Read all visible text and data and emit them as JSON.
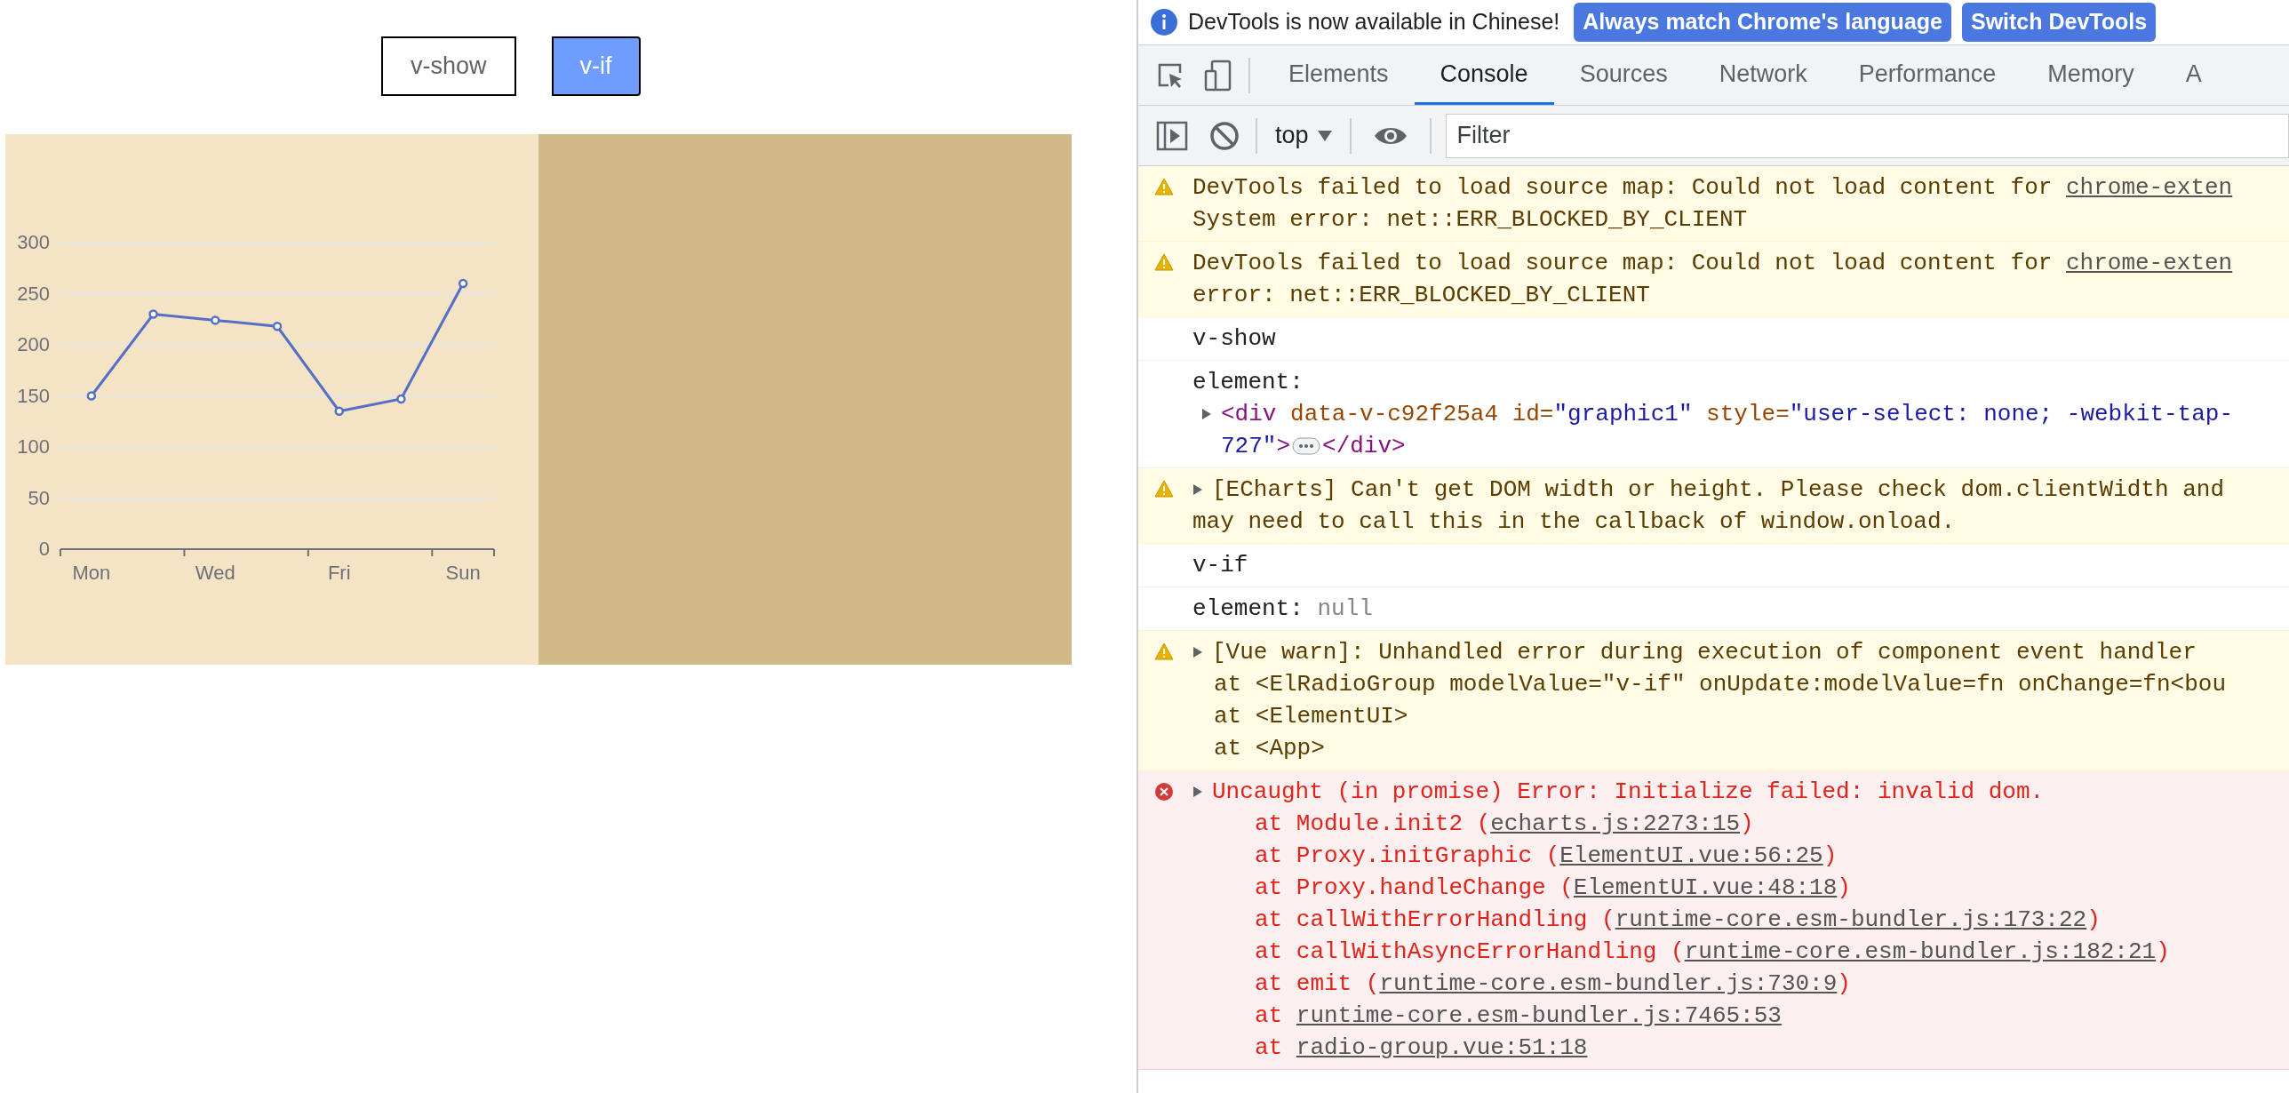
{
  "page": {
    "radio_buttons": [
      {
        "label": "v-show",
        "selected": false
      },
      {
        "label": "v-if",
        "selected": true
      }
    ],
    "chart": {
      "chart_data": {
        "type": "line",
        "categories": [
          "Mon",
          null,
          "Wed",
          null,
          "Fri",
          null,
          "Sun"
        ],
        "ylim": [
          0,
          300
        ],
        "grid": true,
        "yticks": [
          0,
          50,
          100,
          150,
          200,
          250,
          300
        ],
        "series": [
          {
            "color": "#5470c6",
            "marker": "circle",
            "values": [
              150,
              230,
              224,
              218,
              135,
              147,
              260
            ]
          }
        ]
      }
    }
  },
  "devtools": {
    "infobar": {
      "message": "DevTools is now available in Chinese!",
      "buttons": [
        "Always match Chrome's language",
        "Switch DevTools"
      ]
    },
    "tabs": [
      {
        "label": "Elements",
        "selected": false
      },
      {
        "label": "Console",
        "selected": true
      },
      {
        "label": "Sources",
        "selected": false
      },
      {
        "label": "Network",
        "selected": false
      },
      {
        "label": "Performance",
        "selected": false
      },
      {
        "label": "Memory",
        "selected": false
      },
      {
        "label": "A",
        "selected": false
      }
    ],
    "toolbar": {
      "context": "top",
      "filter_placeholder": "Filter"
    },
    "console": [
      {
        "kind": "warning",
        "expandable": false,
        "lines": [
          {
            "text": "DevTools failed to load source map: Could not load content for ",
            "link": "chrome-exten"
          },
          {
            "text": "System error: net::ERR_BLOCKED_BY_CLIENT"
          }
        ]
      },
      {
        "kind": "warning",
        "expandable": false,
        "lines": [
          {
            "text": "DevTools failed to load source map: Could not load content for ",
            "link": "chrome-exten"
          },
          {
            "text": "error: net::ERR_BLOCKED_BY_CLIENT"
          }
        ]
      },
      {
        "kind": "log",
        "expandable": false,
        "lines": [
          {
            "text": "v-show"
          }
        ]
      },
      {
        "kind": "log",
        "expandable": false,
        "lines": [
          {
            "text": "element:"
          }
        ],
        "node": [
          [
            {
              "kind": "tag",
              "text": "<div"
            },
            {
              "kind": "attr",
              "text": " data-v-c92f25a4"
            },
            {
              "kind": "attr",
              "text": " id="
            },
            {
              "kind": "value",
              "text": "\"graphic1\""
            },
            {
              "kind": "attr",
              "text": " style="
            },
            {
              "kind": "value",
              "text": "\"user-select: none; -webkit-tap-"
            }
          ],
          [
            {
              "kind": "value",
              "text": "727\""
            },
            {
              "kind": "tag",
              "text": ">"
            },
            {
              "kind": "ellipsis"
            },
            {
              "kind": "tag",
              "text": "</div>"
            }
          ]
        ]
      },
      {
        "kind": "warning",
        "expandable": true,
        "lines": [
          {
            "text": "[ECharts] Can't get DOM width or height. Please check dom.clientWidth and"
          },
          {
            "text": "may need to call this in the callback of window.onload."
          }
        ]
      },
      {
        "kind": "log",
        "expandable": false,
        "lines": [
          {
            "text": "v-if"
          }
        ]
      },
      {
        "kind": "log",
        "expandable": false,
        "lines": [
          {
            "text": "element: ",
            "value": "null"
          }
        ]
      },
      {
        "kind": "warning",
        "expandable": true,
        "lines": [
          {
            "text": "[Vue warn]: Unhandled error during execution of component event handler"
          }
        ],
        "details": [
          {
            "text": "at <ElRadioGroup modelValue=\"v-if\" onUpdate:modelValue=fn onChange=fn<bou"
          },
          {
            "text": "at <ElementUI>"
          },
          {
            "text": "at <App>"
          }
        ]
      },
      {
        "kind": "error",
        "expandable": true,
        "lines": [
          {
            "text": "Uncaught (in promise) Error: Initialize failed: invalid dom."
          }
        ],
        "stack": [
          {
            "text": "at Module.init2 (",
            "link": "echarts.js:2273:15",
            "after": ")"
          },
          {
            "text": "at Proxy.initGraphic (",
            "link": "ElementUI.vue:56:25",
            "after": ")"
          },
          {
            "text": "at Proxy.handleChange (",
            "link": "ElementUI.vue:48:18",
            "after": ")"
          },
          {
            "text": "at callWithErrorHandling (",
            "link": "runtime-core.esm-bundler.js:173:22",
            "after": ")"
          },
          {
            "text": "at callWithAsyncErrorHandling (",
            "link": "runtime-core.esm-bundler.js:182:21",
            "after": ")"
          },
          {
            "text": "at emit (",
            "link": "runtime-core.esm-bundler.js:730:9",
            "after": ")"
          },
          {
            "text": "at ",
            "link": "runtime-core.esm-bundler.js:7465:53"
          },
          {
            "text": "at ",
            "link": "radio-group.vue:51:18"
          }
        ]
      }
    ]
  }
}
